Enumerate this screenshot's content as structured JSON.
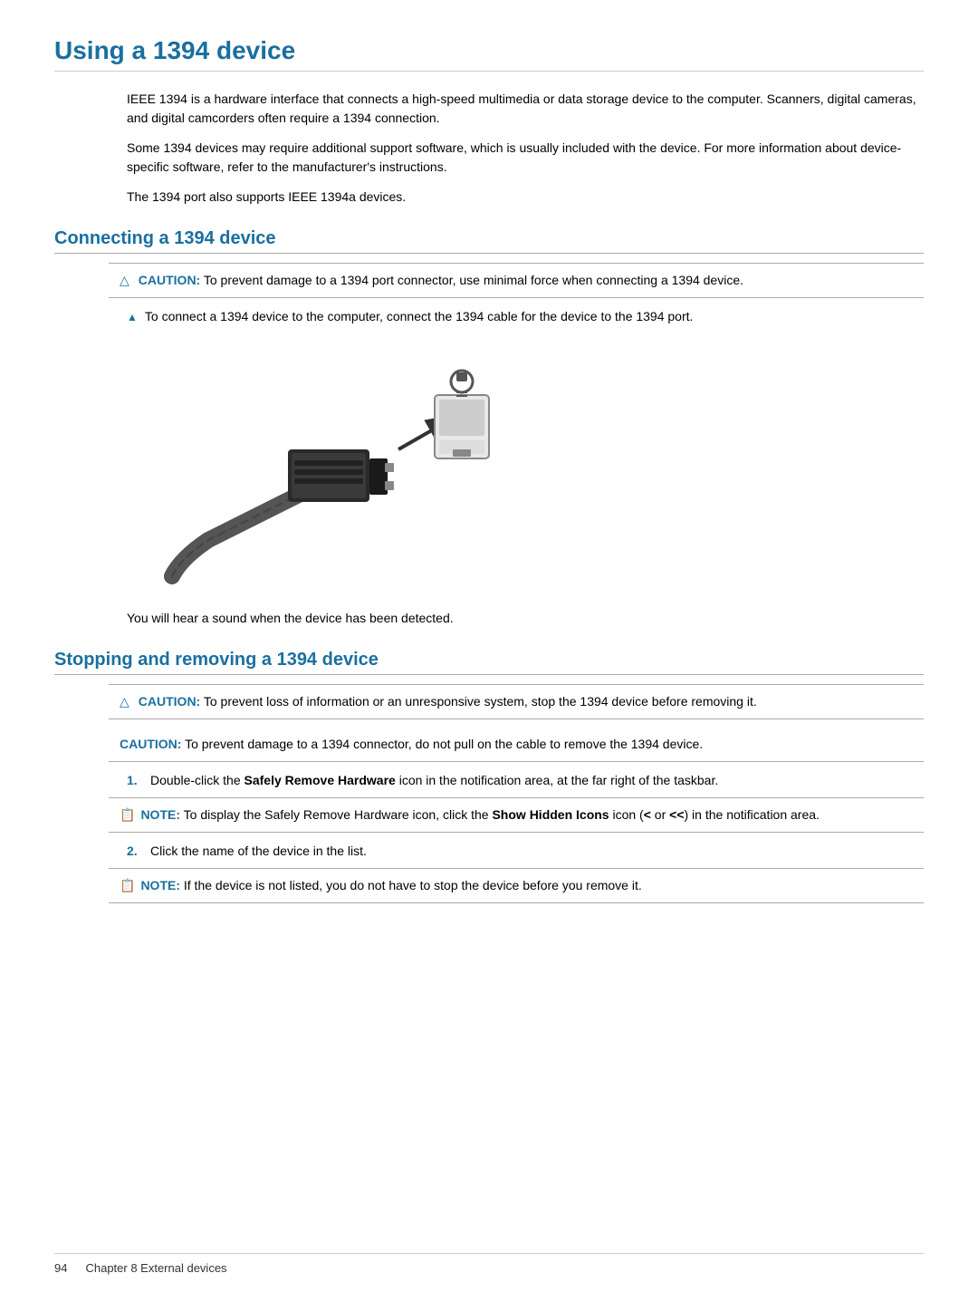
{
  "page": {
    "title": "Using a 1394 device",
    "footer_page": "94",
    "footer_chapter": "Chapter 8    External devices"
  },
  "intro": {
    "paragraph1": "IEEE 1394 is a hardware interface that connects a high-speed multimedia or data storage device to the computer. Scanners, digital cameras, and digital camcorders often require a 1394 connection.",
    "paragraph2": "Some 1394 devices may require additional support software, which is usually included with the device. For more information about device-specific software, refer to the manufacturer's instructions.",
    "paragraph3": "The 1394 port also supports IEEE 1394a devices."
  },
  "connecting": {
    "title": "Connecting a 1394 device",
    "caution_label": "CAUTION:",
    "caution_text": "To prevent damage to a 1394 port connector, use minimal force when connecting a 1394 device.",
    "bullet_text": "To connect a 1394 device to the computer, connect the 1394 cable for the device to the 1394 port.",
    "image_caption": "You will hear a sound when the device has been detected."
  },
  "stopping": {
    "title": "Stopping and removing a 1394 device",
    "caution1_label": "CAUTION:",
    "caution1_text": "To prevent loss of information or an unresponsive system, stop the 1394 device before removing it.",
    "caution2_label": "CAUTION:",
    "caution2_text": "To prevent damage to a 1394 connector, do not pull on the cable to remove the 1394 device.",
    "step1_num": "1.",
    "step1_text": "Double-click the ",
    "step1_bold": "Safely Remove Hardware",
    "step1_text2": " icon in the notification area, at the far right of the taskbar.",
    "note1_label": "NOTE:",
    "note1_text": "To display the Safely Remove Hardware icon, click the ",
    "note1_bold": "Show Hidden Icons",
    "note1_text2": " icon (",
    "note1_code": "< or <<",
    "note1_text3": ") in the notification area.",
    "step2_num": "2.",
    "step2_text": "Click the name of the device in the list.",
    "note2_label": "NOTE:",
    "note2_text": "If the device is not listed, you do not have to stop the device before you remove it."
  }
}
